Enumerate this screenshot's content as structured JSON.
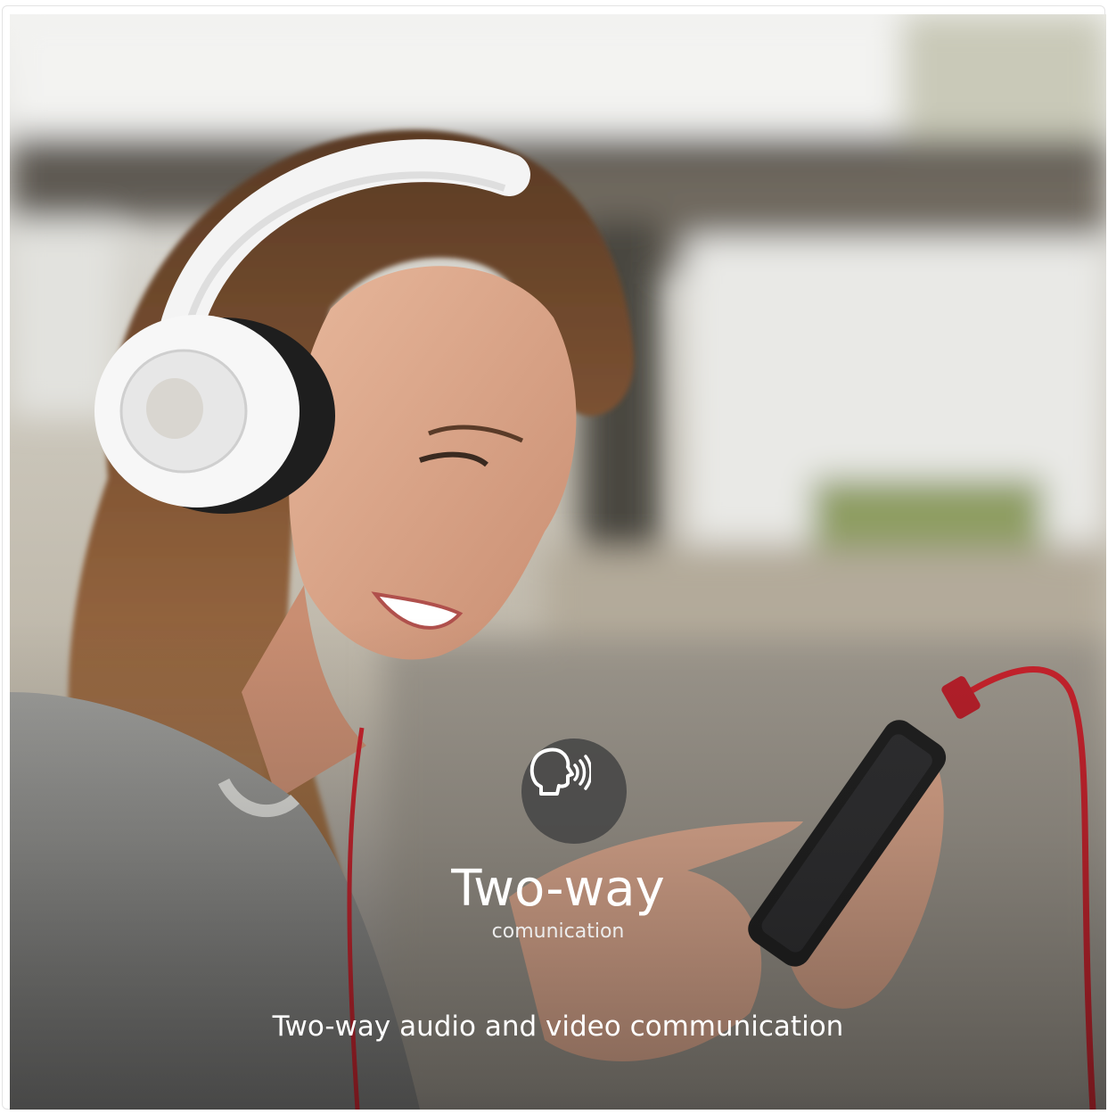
{
  "feature": {
    "icon": "speaking-head-icon",
    "title": "Two-way",
    "subtitle": "comunication",
    "caption": "Two-way audio and video communication"
  },
  "colors": {
    "badge_background": "#464646",
    "text": "#ffffff",
    "cable_red": "#c8222c"
  }
}
